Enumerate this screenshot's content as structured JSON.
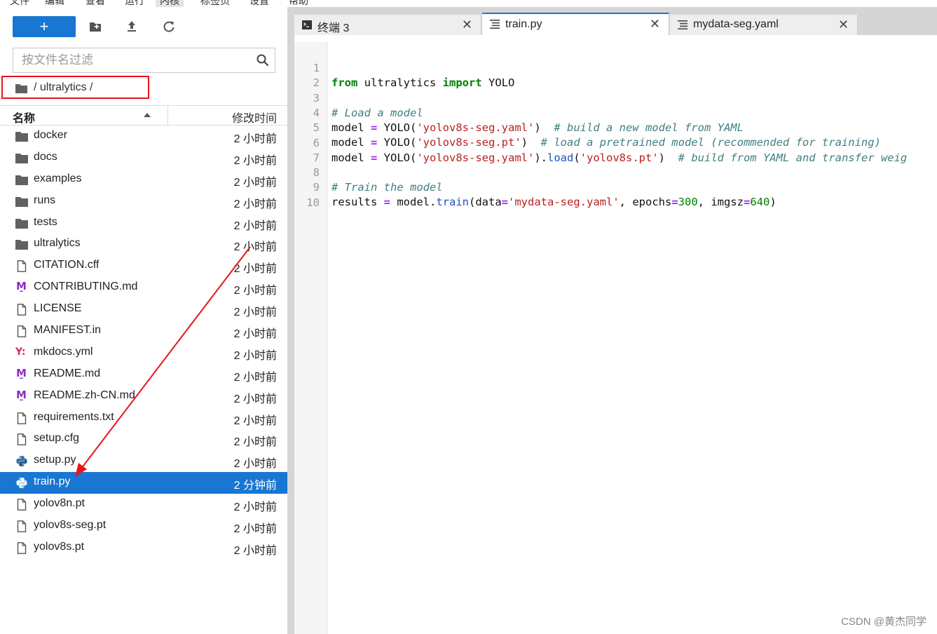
{
  "menubar": {
    "items": [
      "文件",
      "编辑",
      "查看",
      "运行",
      "内核",
      "标签页",
      "设置",
      "帮助"
    ],
    "active_index": 4
  },
  "file_browser": {
    "new_button_label": "+",
    "toolbar_icons": [
      "new-folder-icon",
      "upload-icon",
      "refresh-icon"
    ],
    "filter": {
      "placeholder": "按文件名过滤",
      "value": ""
    },
    "breadcrumb": "/ ultralytics /",
    "header": {
      "name": "名称",
      "modified": "修改时间",
      "sort": "ascending"
    },
    "files": [
      {
        "name": "docker",
        "type": "folder",
        "modified": "2 小时前"
      },
      {
        "name": "docs",
        "type": "folder",
        "modified": "2 小时前"
      },
      {
        "name": "examples",
        "type": "folder",
        "modified": "2 小时前"
      },
      {
        "name": "runs",
        "type": "folder",
        "modified": "2 小时前"
      },
      {
        "name": "tests",
        "type": "folder",
        "modified": "2 小时前"
      },
      {
        "name": "ultralytics",
        "type": "folder",
        "modified": "2 小时前"
      },
      {
        "name": "CITATION.cff",
        "type": "file",
        "modified": "2 小时前"
      },
      {
        "name": "CONTRIBUTING.md",
        "type": "markdown",
        "modified": "2 小时前"
      },
      {
        "name": "LICENSE",
        "type": "file",
        "modified": "2 小时前"
      },
      {
        "name": "MANIFEST.in",
        "type": "file",
        "modified": "2 小时前"
      },
      {
        "name": "mkdocs.yml",
        "type": "yaml",
        "modified": "2 小时前"
      },
      {
        "name": "README.md",
        "type": "markdown",
        "modified": "2 小时前"
      },
      {
        "name": "README.zh-CN.md",
        "type": "markdown",
        "modified": "2 小时前"
      },
      {
        "name": "requirements.txt",
        "type": "file",
        "modified": "2 小时前"
      },
      {
        "name": "setup.cfg",
        "type": "file",
        "modified": "2 小时前"
      },
      {
        "name": "setup.py",
        "type": "python",
        "modified": "2 小时前"
      },
      {
        "name": "train.py",
        "type": "python",
        "modified": "2 分钟前",
        "selected": true
      },
      {
        "name": "yolov8n.pt",
        "type": "file",
        "modified": "2 小时前"
      },
      {
        "name": "yolov8s-seg.pt",
        "type": "file",
        "modified": "2 小时前"
      },
      {
        "name": "yolov8s.pt",
        "type": "file",
        "modified": "2 小时前"
      }
    ]
  },
  "tabs": [
    {
      "label": "终端 3",
      "icon": "terminal-icon",
      "active": false
    },
    {
      "label": "train.py",
      "icon": "text-file-icon",
      "active": true
    },
    {
      "label": "mydata-seg.yaml",
      "icon": "text-file-icon",
      "active": false
    }
  ],
  "editor": {
    "line_numbers": [
      "1",
      "2",
      "3",
      "4",
      "5",
      "6",
      "7",
      "8",
      "9",
      "10"
    ]
  },
  "watermark": "CSDN @黄杰同学",
  "colors": {
    "accent": "#1976d2",
    "annotation_red": "#e8141c",
    "keyword": "#008000",
    "string": "#ba2121",
    "comment": "#408080"
  }
}
